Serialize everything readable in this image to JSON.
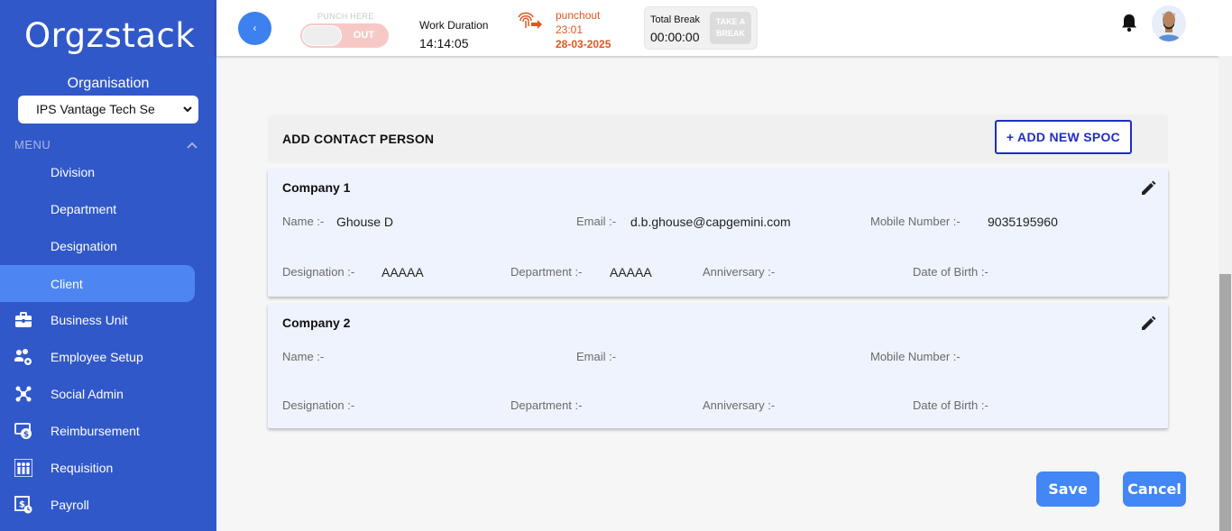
{
  "sidebar": {
    "logo": "Orgzstack",
    "org_label": "Organisation",
    "org_selected": "IPS Vantage Tech Se",
    "menu_label": "MENU",
    "items": [
      {
        "label": "Division",
        "icon": ""
      },
      {
        "label": "Department",
        "icon": ""
      },
      {
        "label": "Designation",
        "icon": ""
      },
      {
        "label": "Client",
        "icon": ""
      },
      {
        "label": "Business Unit",
        "icon": "briefcase-icon"
      },
      {
        "label": "Employee Setup",
        "icon": "users-gear-icon"
      },
      {
        "label": "Social Admin",
        "icon": "share-icon"
      },
      {
        "label": "Reimbursement",
        "icon": "money-icon"
      },
      {
        "label": "Requisition",
        "icon": "people-icon"
      },
      {
        "label": "Payroll",
        "icon": "payroll-icon"
      }
    ]
  },
  "topbar": {
    "back_glyph": "‹",
    "punch_here": "PUNCH HERE",
    "toggle_state": "OUT",
    "work_duration_label": "Work Duration",
    "work_duration_value": "14:14:05",
    "punchout_label": "punchout",
    "punchout_time": "23:01",
    "punchout_date": "28-03-2025",
    "total_break_label": "Total Break",
    "total_break_value": "00:00:00",
    "take_break_line1": "TAKE A",
    "take_break_line2": "BREAK"
  },
  "card": {
    "title": "ADD CONTACT PERSON",
    "add_button": "+ ADD NEW SPOC",
    "labels": {
      "name": "Name :-",
      "email": "Email :-",
      "mobile": "Mobile Number :-",
      "designation": "Designation :-",
      "department": "Department :-",
      "anniversary": "Anniversary :-",
      "dob": "Date of Birth :-"
    },
    "companies": [
      {
        "name": "Company 1",
        "contact_name": "Ghouse D",
        "email": "d.b.ghouse@capgemini.com",
        "mobile": "9035195960",
        "designation": "AAAAA",
        "department": "AAAAA",
        "anniversary": "",
        "dob": ""
      },
      {
        "name": "Company 2",
        "contact_name": "",
        "email": "",
        "mobile": "",
        "designation": "",
        "department": "",
        "anniversary": "",
        "dob": ""
      }
    ]
  },
  "actions": {
    "save": "Save",
    "cancel": "Cancel"
  },
  "colors": {
    "sidebar_bg": "#3158c9",
    "active_item": "#4d86f2",
    "primary_button": "#4386f5",
    "spoc_border": "#1f2ec2",
    "punchout_orange": "#e2561e"
  }
}
